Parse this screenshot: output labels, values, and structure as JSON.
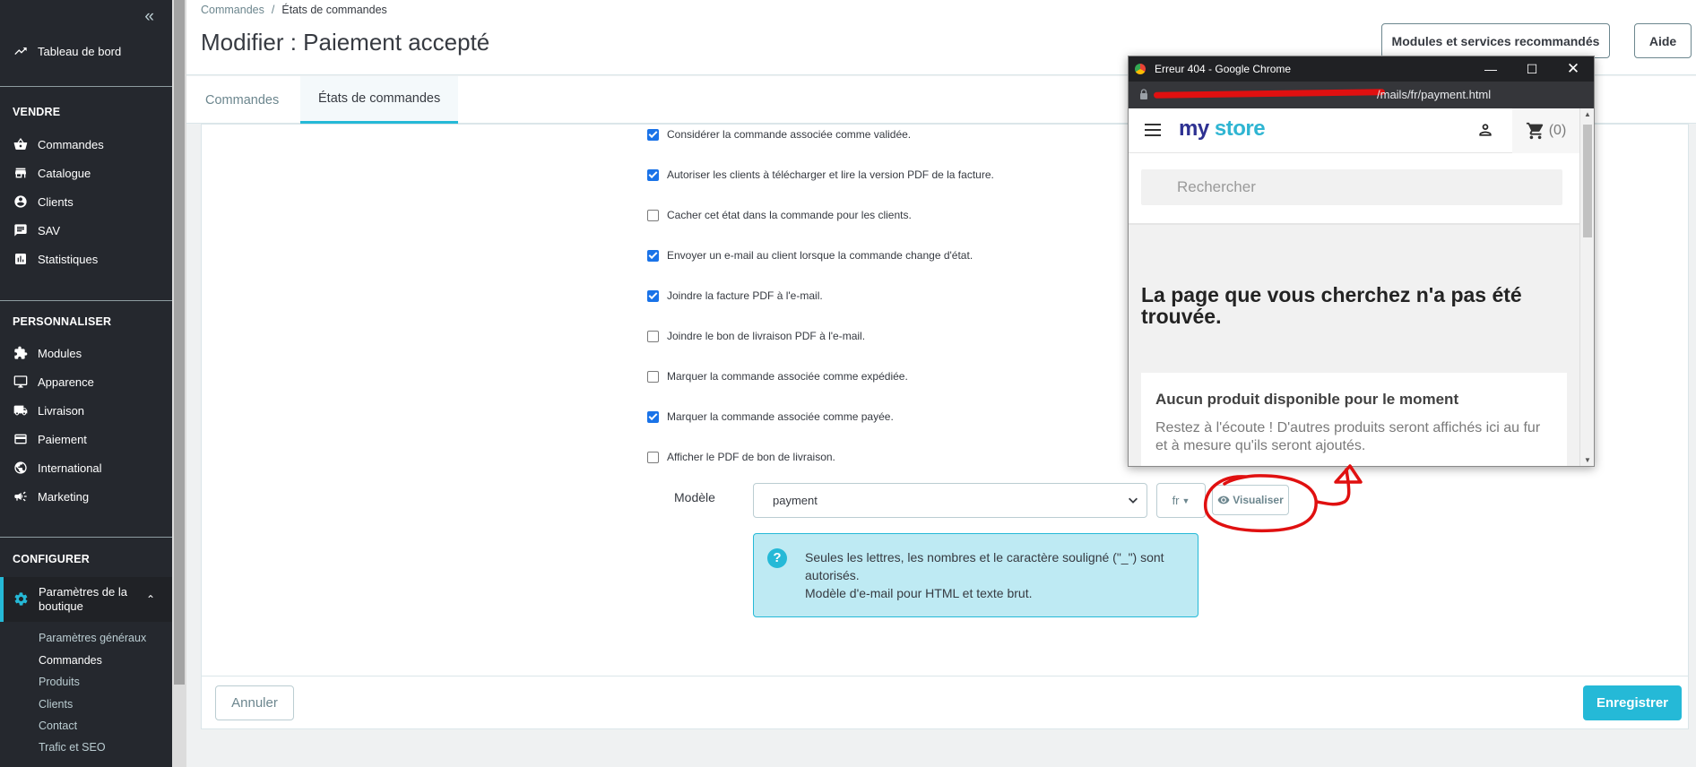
{
  "sidebar": {
    "dashboard": "Tableau de bord",
    "sections": {
      "sell": "VENDRE",
      "customize": "PERSONNALISER",
      "configure": "CONFIGURER"
    },
    "sell_items": [
      "Commandes",
      "Catalogue",
      "Clients",
      "SAV",
      "Statistiques"
    ],
    "customize_items": [
      "Modules",
      "Apparence",
      "Livraison",
      "Paiement",
      "International",
      "Marketing"
    ],
    "active_item": "Paramètres de la boutique",
    "sub_items": [
      "Paramètres généraux",
      "Commandes",
      "Produits",
      "Clients",
      "Contact",
      "Trafic et SEO"
    ]
  },
  "header": {
    "breadcrumb": [
      "Commandes",
      "États de commandes"
    ],
    "title": "Modifier : Paiement accepté",
    "btn_modules": "Modules et services recommandés",
    "btn_help": "Aide"
  },
  "tabs": [
    "Commandes",
    "États de commandes"
  ],
  "form": {
    "checkboxes": [
      {
        "label": "Considérer la commande associée comme validée.",
        "checked": true
      },
      {
        "label": "Autoriser les clients à télécharger et lire la version PDF de la facture.",
        "checked": true
      },
      {
        "label": "Cacher cet état dans la commande pour les clients.",
        "checked": false
      },
      {
        "label": "Envoyer un e-mail au client lorsque la commande change d'état.",
        "checked": true
      },
      {
        "label": "Joindre la facture PDF à l'e-mail.",
        "checked": true
      },
      {
        "label": "Joindre le bon de livraison PDF à l'e-mail.",
        "checked": false
      },
      {
        "label": "Marquer la commande associée comme expédiée.",
        "checked": false
      },
      {
        "label": "Marquer la commande associée comme payée.",
        "checked": true
      },
      {
        "label": "Afficher le PDF de bon de livraison.",
        "checked": false
      }
    ],
    "template_label": "Modèle",
    "template_value": "payment",
    "lang_value": "fr",
    "preview_label": "Visualiser",
    "alert_line1": "Seules les lettres, les nombres et le caractère souligné (\"_\") sont autorisés.",
    "alert_line2": "Modèle d'e-mail pour HTML et texte brut.",
    "cancel_label": "Annuler",
    "save_label": "Enregistrer"
  },
  "popup": {
    "window_title": "Erreur 404 - Google Chrome",
    "url_suffix": "/mails/fr/payment.html",
    "logo_my": "my",
    "logo_store": "store",
    "cart_count": "(0)",
    "search_placeholder": "Rechercher",
    "not_found_heading": "La page que vous cherchez n'a pas été trouvée.",
    "no_products_heading": "Aucun produit disponible pour le moment",
    "no_products_text": "Restez à l'écoute ! D'autres produits seront affichés ici au fur et à mesure qu'ils seront ajoutés."
  },
  "colors": {
    "sidebar_bg": "#25282e",
    "accent": "#25b9d7",
    "checkbox_checked": "#1a73e8",
    "annotation_red": "#e01010"
  }
}
